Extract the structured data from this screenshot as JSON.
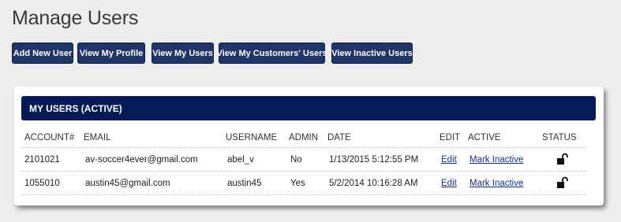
{
  "page": {
    "title": "Manage Users"
  },
  "toolbar": {
    "buttons": [
      "Add New User",
      "View My Profile",
      "View My Users",
      "View My Customers' Users",
      "View Inactive Users"
    ]
  },
  "panel": {
    "title": "MY USERS (ACTIVE)",
    "columns": [
      "ACCOUNT#",
      "EMAIL",
      "USERNAME",
      "ADMIN",
      "DATE",
      "EDIT",
      "ACTIVE",
      "STATUS"
    ],
    "rows": [
      {
        "account": "2101021",
        "email": "av-soccer4ever@gmail.com",
        "username": "abel_v",
        "admin": "No",
        "date": "1/13/2015 5:12:55 PM",
        "edit": "Edit",
        "active": "Mark Inactive",
        "status_icon": "unlocked-padlock-icon"
      },
      {
        "account": "1055010",
        "email": "austin45@gmail.com",
        "username": "austin45",
        "admin": "Yes",
        "date": "5/2/2014 10:16:28 AM",
        "edit": "Edit",
        "active": "Mark Inactive",
        "status_icon": "unlocked-padlock-icon"
      }
    ]
  },
  "colors": {
    "button_bg": "#1f3467",
    "header_bg": "#041b57",
    "link": "#1a2f8a",
    "page_bg": "#ededed"
  }
}
